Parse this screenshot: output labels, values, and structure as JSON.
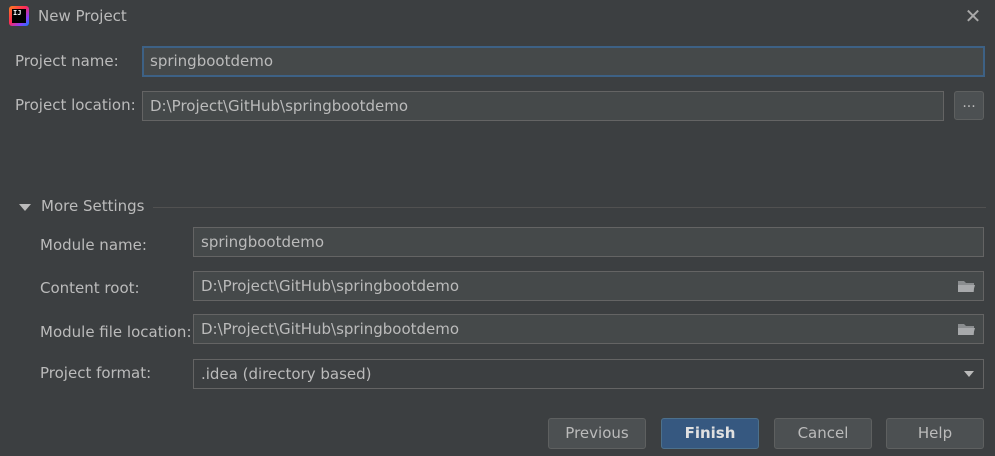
{
  "window": {
    "title": "New Project",
    "close_glyph": "✕",
    "app_icon_text": "IJ"
  },
  "form": {
    "project_name": {
      "label": "Project name:",
      "value": "springbootdemo"
    },
    "project_location": {
      "label": "Project location:",
      "value": "D:\\Project\\GitHub\\springbootdemo",
      "browse_label": "..."
    }
  },
  "more_settings": {
    "label": "More Settings",
    "expanded": true,
    "module_name": {
      "label": "Module name:",
      "value": "springbootdemo"
    },
    "content_root": {
      "label": "Content root:",
      "value": "D:\\Project\\GitHub\\springbootdemo",
      "icon": "folder-icon"
    },
    "module_file_location": {
      "label": "Module file location:",
      "value": "D:\\Project\\GitHub\\springbootdemo",
      "icon": "folder-icon"
    },
    "project_format": {
      "label": "Project format:",
      "selected": ".idea (directory based)"
    }
  },
  "buttons": {
    "previous": "Previous",
    "finish": "Finish",
    "cancel": "Cancel",
    "help": "Help"
  },
  "colors": {
    "background": "#3c3f41",
    "field_background": "#45494a",
    "focus_border": "#3d6185",
    "primary_button": "#365880"
  }
}
